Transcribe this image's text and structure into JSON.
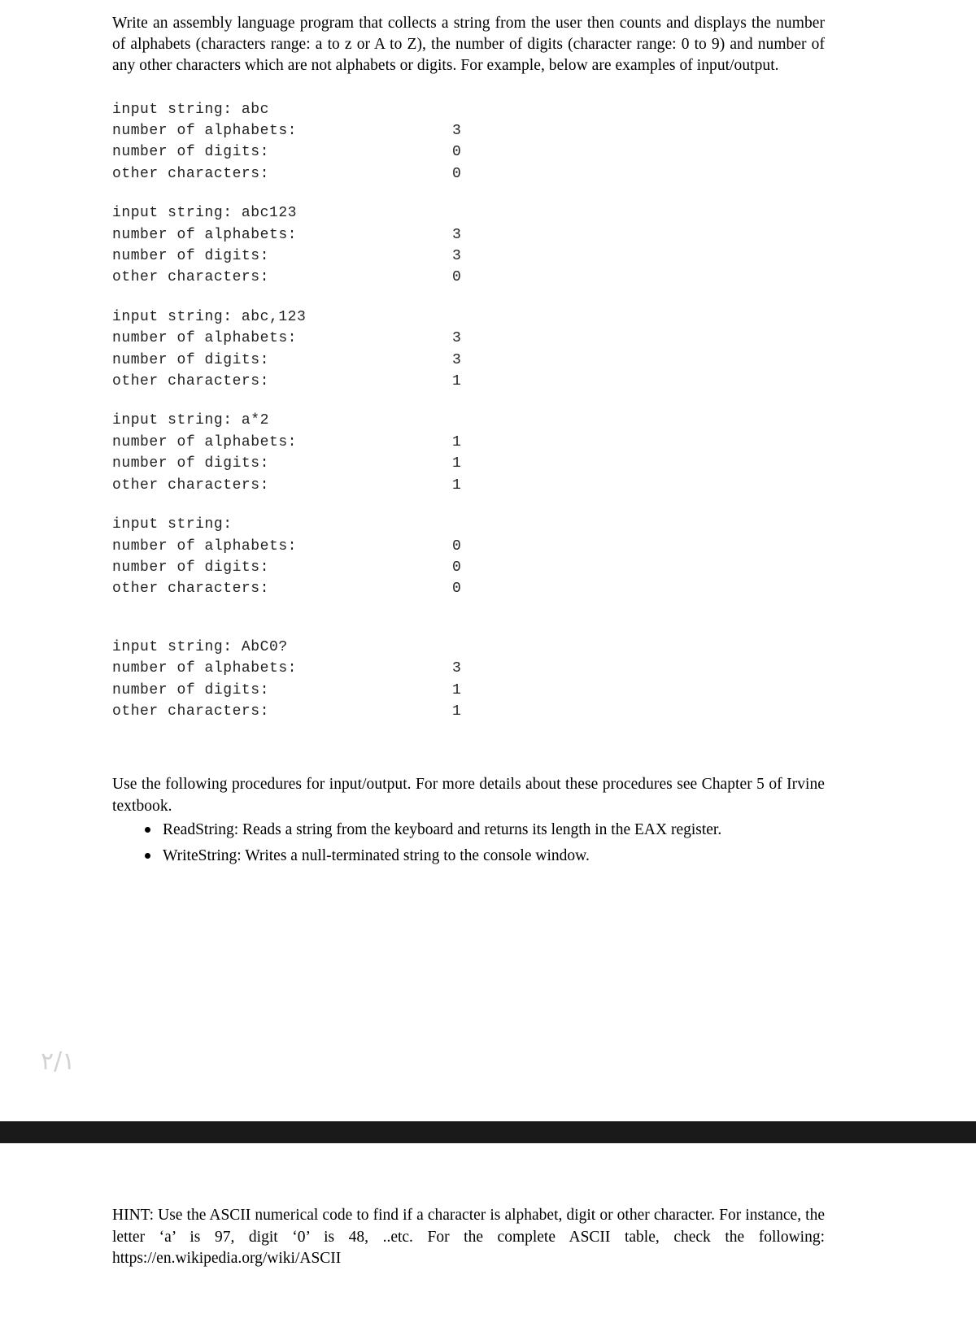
{
  "document": {
    "intro_paragraph": "Write an assembly language program that collects a string from the user then counts and displays the number of alphabets (characters range: a to z or A to Z), the number of  digits (character range: 0 to 9) and number of any other characters which are not alphabets or digits. For example, below are examples of input/output.",
    "examples": [
      {
        "input_line": "input string: abc",
        "rows": [
          {
            "label": "number of alphabets:",
            "value": "3"
          },
          {
            "label": "number of digits:",
            "value": "0"
          },
          {
            "label": "other characters:",
            "value": "0"
          }
        ]
      },
      {
        "input_line": "input string: abc123",
        "rows": [
          {
            "label": "number of alphabets:",
            "value": "3"
          },
          {
            "label": "number of digits:",
            "value": "3"
          },
          {
            "label": "other characters:",
            "value": "0"
          }
        ]
      },
      {
        "input_line": "input string: abc,123",
        "rows": [
          {
            "label": "number of alphabets:",
            "value": "3"
          },
          {
            "label": "number of digits:",
            "value": "3"
          },
          {
            "label": "other characters:",
            "value": "1"
          }
        ]
      },
      {
        "input_line": "input string: a*2",
        "rows": [
          {
            "label": "number of alphabets:",
            "value": "1"
          },
          {
            "label": "number of digits:",
            "value": "1"
          },
          {
            "label": "other characters:",
            "value": "1"
          }
        ]
      },
      {
        "input_line": "input string:",
        "rows": [
          {
            "label": "number of alphabets:",
            "value": "0"
          },
          {
            "label": "number of digits:",
            "value": "0"
          },
          {
            "label": "other characters:",
            "value": "0"
          }
        ]
      },
      {
        "input_line": "input string: AbC0?",
        "rows": [
          {
            "label": "number of alphabets:",
            "value": "3"
          },
          {
            "label": "number of digits:",
            "value": "1"
          },
          {
            "label": "other characters:",
            "value": "1"
          }
        ]
      }
    ],
    "procedures_paragraph": "Use the following procedures for input/output. For more details about these procedures see Chapter 5 of Irvine textbook.",
    "procedure_bullets": [
      "ReadString: Reads a string from the keyboard and returns its length in the EAX register.",
      "WriteString: Writes a null-terminated string to the console window."
    ],
    "page_marker": "٢/١",
    "hint_paragraph": "HINT: Use the ASCII numerical code to find if a character is alphabet, digit or other character. For instance, the letter ‘a’ is 97, digit ‘0’ is 48, ..etc. For the complete ASCII table, check the following: https://en.wikipedia.org/wiki/ASCII"
  },
  "colors": {
    "page_background": "#ffffff",
    "body_text": "#000000",
    "code_text": "#222222",
    "separator_bar": "#1a1a1a",
    "page_marker": "#d2d2d2"
  }
}
